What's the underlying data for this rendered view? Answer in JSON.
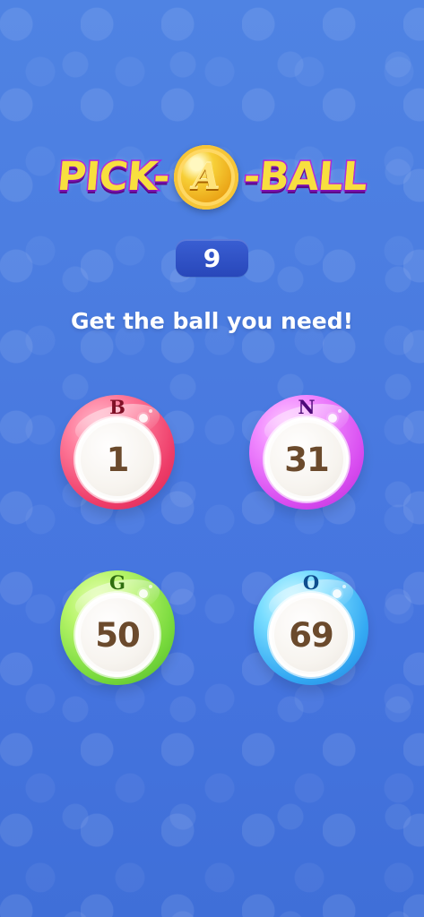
{
  "header": {
    "title_left": "PICK-",
    "title_right": "-BALL",
    "coin_letter": "A"
  },
  "counter": {
    "value": "9"
  },
  "subtitle": "Get the ball you need!",
  "balls": [
    {
      "letter": "B",
      "number": "1",
      "color": "#ee3d69"
    },
    {
      "letter": "N",
      "number": "31",
      "color": "#d84df0"
    },
    {
      "letter": "G",
      "number": "50",
      "color": "#77d93c"
    },
    {
      "letter": "O",
      "number": "69",
      "color": "#34a9f3"
    }
  ],
  "colors": {
    "background": "#4a7be0",
    "title_fill": "#f8df3f",
    "title_stroke": "#a91bdc",
    "counter_bg": "#2847ba"
  }
}
